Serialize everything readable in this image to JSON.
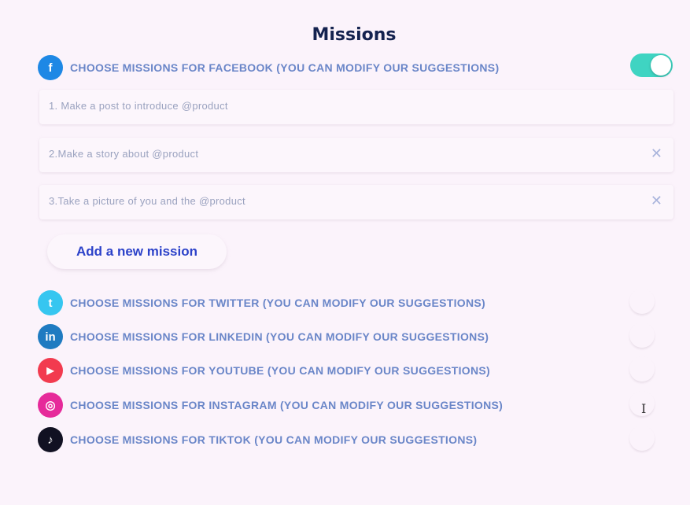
{
  "title": "Missions",
  "networks": [
    {
      "id": "facebook",
      "icon_text": "f",
      "icon": "facebook-icon",
      "color": "#1e88e5",
      "label": "CHOOSE MISSIONS FOR FACEBOOK (YOU CAN MODIFY OUR SUGGESTIONS)",
      "enabled": true
    },
    {
      "id": "twitter",
      "icon_text": "t",
      "icon": "twitter-icon",
      "color": "#36c6f0",
      "label": "CHOOSE MISSIONS FOR TWITTER (YOU CAN MODIFY OUR SUGGESTIONS)",
      "enabled": false
    },
    {
      "id": "linkedin",
      "icon_text": "in",
      "icon": "linkedin-icon",
      "color": "#1f7bc1",
      "label": "CHOOSE MISSIONS FOR LINKEDIN (YOU CAN MODIFY OUR SUGGESTIONS)",
      "enabled": false
    },
    {
      "id": "youtube",
      "icon_text": "▶",
      "icon": "youtube-icon",
      "color": "#f23b4f",
      "label": "CHOOSE MISSIONS FOR YOUTUBE (YOU CAN MODIFY OUR SUGGESTIONS)",
      "enabled": false
    },
    {
      "id": "instagram",
      "icon_text": "◎",
      "icon": "instagram-icon",
      "color": "#e62a9a",
      "label": "CHOOSE MISSIONS FOR INSTAGRAM (YOU CAN MODIFY OUR SUGGESTIONS)",
      "enabled": false
    },
    {
      "id": "tiktok",
      "icon_text": "♪",
      "icon": "tiktok-icon",
      "color": "#111122",
      "label": "CHOOSE MISSIONS FOR TIKTOK (YOU CAN MODIFY OUR SUGGESTIONS)",
      "enabled": false
    }
  ],
  "facebook_missions": [
    "1. Make a post to introduce @product",
    "2.Make a story about @product",
    "3.Take a picture of you and the @product"
  ],
  "add_mission_label": "Add a new mission",
  "colors": {
    "accent": "#3fd4c2",
    "link": "#2c42c9",
    "label": "#6a86c8",
    "background": "#fbf3fb"
  }
}
